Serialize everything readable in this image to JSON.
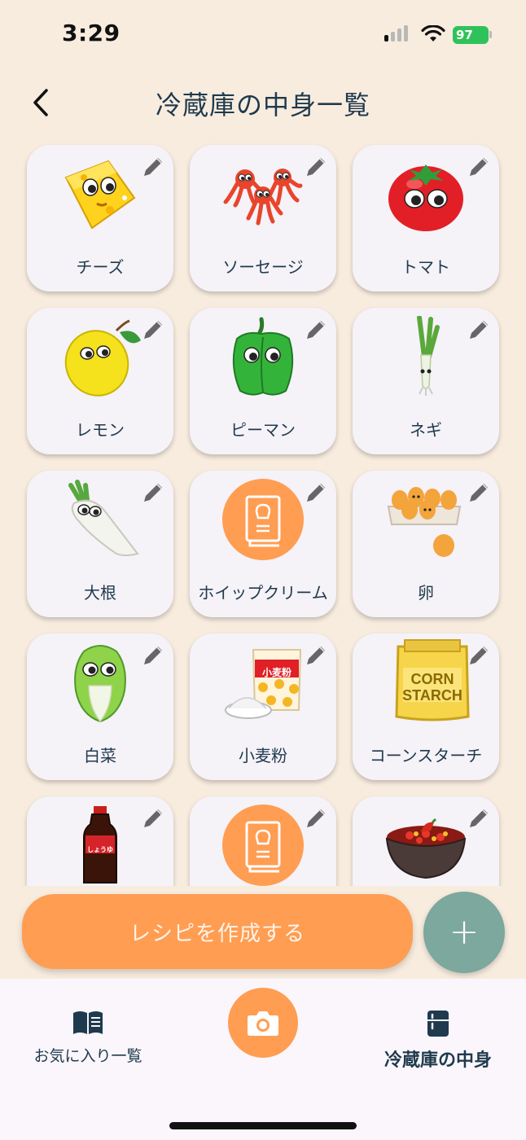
{
  "status_bar": {
    "time": "3:29",
    "battery": "97"
  },
  "header": {
    "title": "冷蔵庫の中身一覧",
    "back_icon": "chevron-left-icon"
  },
  "items": [
    {
      "label": "チーズ",
      "icon": "cheese-icon"
    },
    {
      "label": "ソーセージ",
      "icon": "sausage-icon"
    },
    {
      "label": "トマト",
      "icon": "tomato-icon"
    },
    {
      "label": "レモン",
      "icon": "lemon-icon"
    },
    {
      "label": "ピーマン",
      "icon": "green-pepper-icon"
    },
    {
      "label": "ネギ",
      "icon": "green-onion-icon"
    },
    {
      "label": "大根",
      "icon": "daikon-icon"
    },
    {
      "label": "ホイップクリーム",
      "icon": "recipe-book-icon"
    },
    {
      "label": "卵",
      "icon": "eggs-icon"
    },
    {
      "label": "白菜",
      "icon": "napa-cabbage-icon"
    },
    {
      "label": "小麦粉",
      "icon": "flour-icon"
    },
    {
      "label": "コーンスターチ",
      "icon": "cornstarch-icon"
    },
    {
      "label": "",
      "icon": "soy-sauce-icon"
    },
    {
      "label": "",
      "icon": "recipe-book-icon"
    },
    {
      "label": "",
      "icon": "chili-bowl-icon"
    }
  ],
  "flour_bag_text": "小麦粉",
  "cornstarch_text": [
    "CORN",
    "STARCH"
  ],
  "soy_label_text": "しょうゆ",
  "actions": {
    "create_recipe": "レシピを作成する",
    "add": "+"
  },
  "tab_bar": {
    "favorites": "お気に入り一覧",
    "fridge": "冷蔵庫の中身"
  },
  "colors": {
    "accent": "#ff9d52",
    "add_button": "#7ca89e",
    "background": "#f8ecdf",
    "card": "#f5f2f8",
    "text": "#1f3a4d"
  }
}
